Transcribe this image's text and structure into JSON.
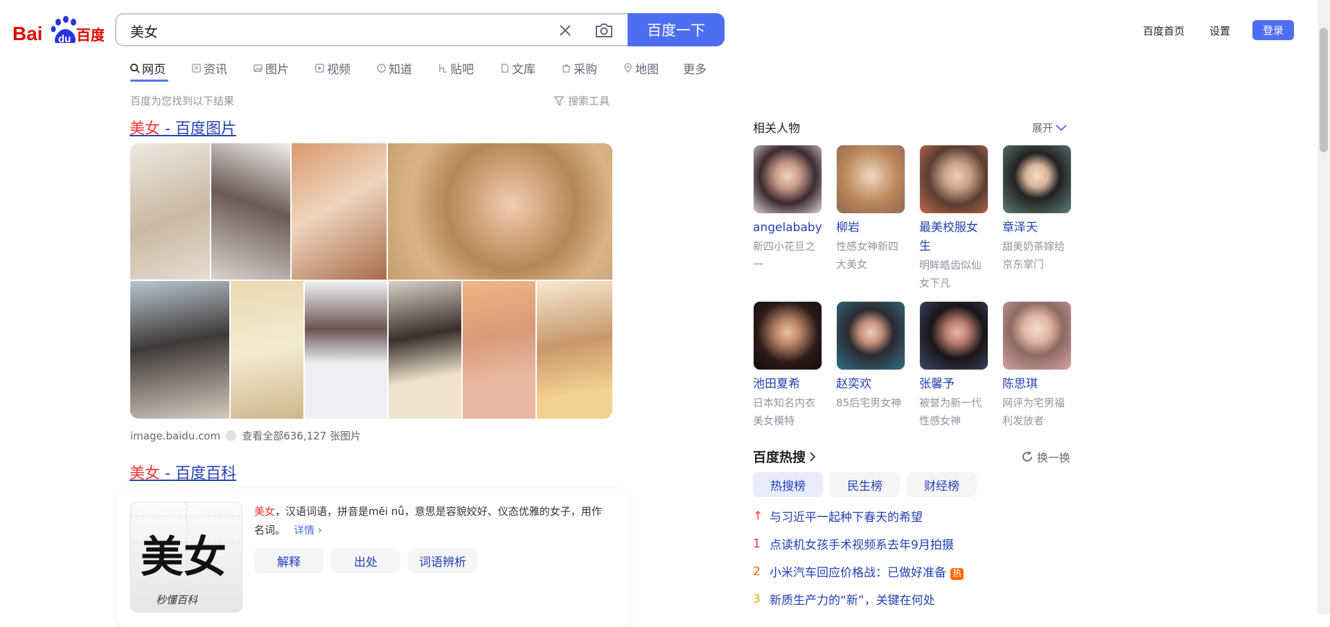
{
  "header": {
    "logo_text": "Bai du 百度",
    "search_value": "美女",
    "search_button": "百度一下",
    "links": [
      "百度首页",
      "设置"
    ],
    "login": "登录",
    "brand_color": "#4e6ef2"
  },
  "tabs": [
    {
      "label": "网页",
      "icon": "search-icon",
      "active": true
    },
    {
      "label": "资讯",
      "icon": "news-icon"
    },
    {
      "label": "图片",
      "icon": "image-icon"
    },
    {
      "label": "视频",
      "icon": "video-icon"
    },
    {
      "label": "知道",
      "icon": "question-icon"
    },
    {
      "label": "贴吧",
      "icon": "tieba-icon"
    },
    {
      "label": "文库",
      "icon": "doc-icon"
    },
    {
      "label": "采购",
      "icon": "bag-icon"
    },
    {
      "label": "地图",
      "icon": "map-icon"
    },
    {
      "label": "更多",
      "icon": ""
    }
  ],
  "result_count": "百度为您找到以下结果",
  "search_tools": "搜索工具",
  "result1": {
    "title_hl": "美女",
    "title_rest": " - 百度图片",
    "source": "image.baidu.com",
    "view_all": "查看全部636,127 张图片"
  },
  "result2": {
    "title_hl": "美女",
    "title_rest": " - 百度百科",
    "desc_hl": "美女",
    "desc": "，汉语词语，拼音是měi nǚ，意思是容貌姣好、仪态优雅的女子，用作名词。",
    "more": "详情",
    "image_text": "美女",
    "image_caption": "秒懂百科",
    "chips": [
      "解释",
      "出处",
      "词语辨析"
    ]
  },
  "people": {
    "title": "相关人物",
    "expand": "展开",
    "items": [
      {
        "name": "angelababy",
        "desc": "新四小花旦之一"
      },
      {
        "name": "柳岩",
        "desc": "性感女神新四大美女"
      },
      {
        "name": "最美校服女生",
        "desc": "明眸皓齿似仙女下凡"
      },
      {
        "name": "章泽天",
        "desc": "甜美奶茶嫁给京东掌门"
      },
      {
        "name": "池田夏希",
        "desc": "日本知名内衣美女模特"
      },
      {
        "name": "赵奕欢",
        "desc": "85后宅男女神"
      },
      {
        "name": "张馨予",
        "desc": "被誉为新一代性感女神"
      },
      {
        "name": "陈思琪",
        "desc": "网评为宅男福利发放者"
      }
    ]
  },
  "hot": {
    "title": "百度热搜",
    "refresh": "换一换",
    "tabs": [
      "热搜榜",
      "民生榜",
      "财经榜"
    ],
    "items": [
      {
        "rank": "↑",
        "text": "与习近平一起种下春天的希望",
        "rank_color": "#f73131"
      },
      {
        "rank": "1",
        "text": "点读机女孩手术视频系去年9月拍摄",
        "rank_color": "#f73131"
      },
      {
        "rank": "2",
        "text": "小米汽车回应价格战：已做好准备",
        "rank_color": "#ff6600",
        "badge": "热"
      },
      {
        "rank": "3",
        "text": "新质生产力的“新”，关键在何处",
        "rank_color": "#faa90e"
      }
    ]
  }
}
